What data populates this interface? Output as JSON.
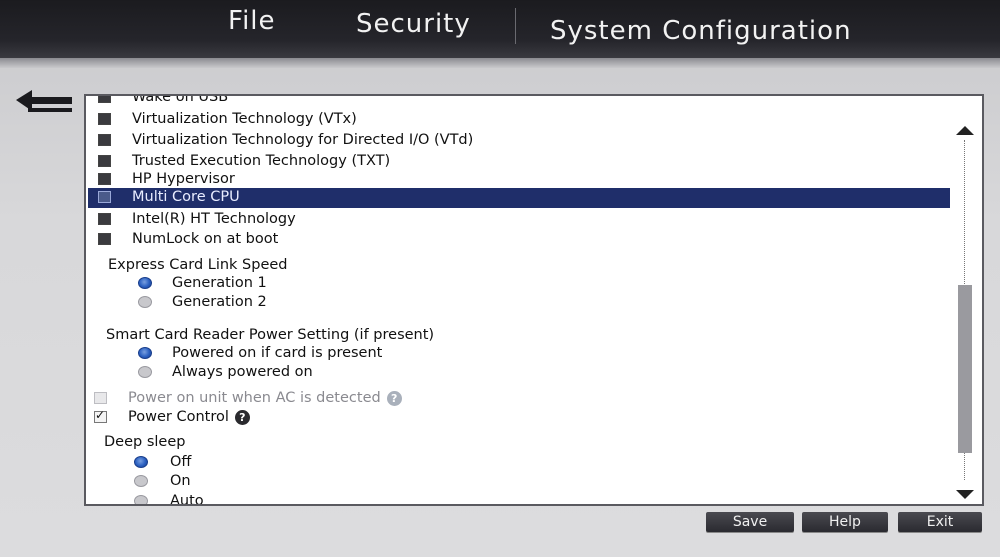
{
  "menu": {
    "file": "File",
    "security": "Security",
    "system_configuration": "System Configuration"
  },
  "list": {
    "partial_top": "Wake on USB",
    "items": [
      {
        "label": "Virtualization Technology (VTx)",
        "state": "checked-dark"
      },
      {
        "label": "Virtualization Technology for Directed I/O (VTd)",
        "state": "checked-dark"
      },
      {
        "label": "Trusted Execution Technology (TXT)",
        "state": "checked-dark"
      },
      {
        "label": "HP Hypervisor",
        "state": "checked-dark"
      },
      {
        "label": "Multi Core CPU",
        "state": "checked-dark",
        "selected": true
      },
      {
        "label": "Intel(R) HT Technology",
        "state": "checked-dark"
      },
      {
        "label": "NumLock on at boot",
        "state": "checked-dark"
      }
    ],
    "express_card": {
      "heading": "Express Card Link Speed",
      "options": [
        "Generation 1",
        "Generation 2"
      ],
      "selected": "Generation 1"
    },
    "smart_card": {
      "heading": "Smart Card Reader Power Setting (if present)",
      "options": [
        "Powered on if card is present",
        "Always powered on"
      ],
      "selected": "Powered on if card is present"
    },
    "power_on_ac": {
      "label": "Power on unit when AC is detected",
      "help": "?"
    },
    "power_control": {
      "label": "Power Control",
      "help": "?"
    },
    "deep_sleep": {
      "heading": "Deep sleep",
      "options": [
        "Off",
        "On",
        "Auto"
      ],
      "selected": "Off"
    }
  },
  "buttons": {
    "save": "Save",
    "help": "Help",
    "exit": "Exit"
  },
  "colors": {
    "selection": "#1f2e6a",
    "radio_on": "#2a5fc0",
    "topbar": "#1b1b1f"
  }
}
